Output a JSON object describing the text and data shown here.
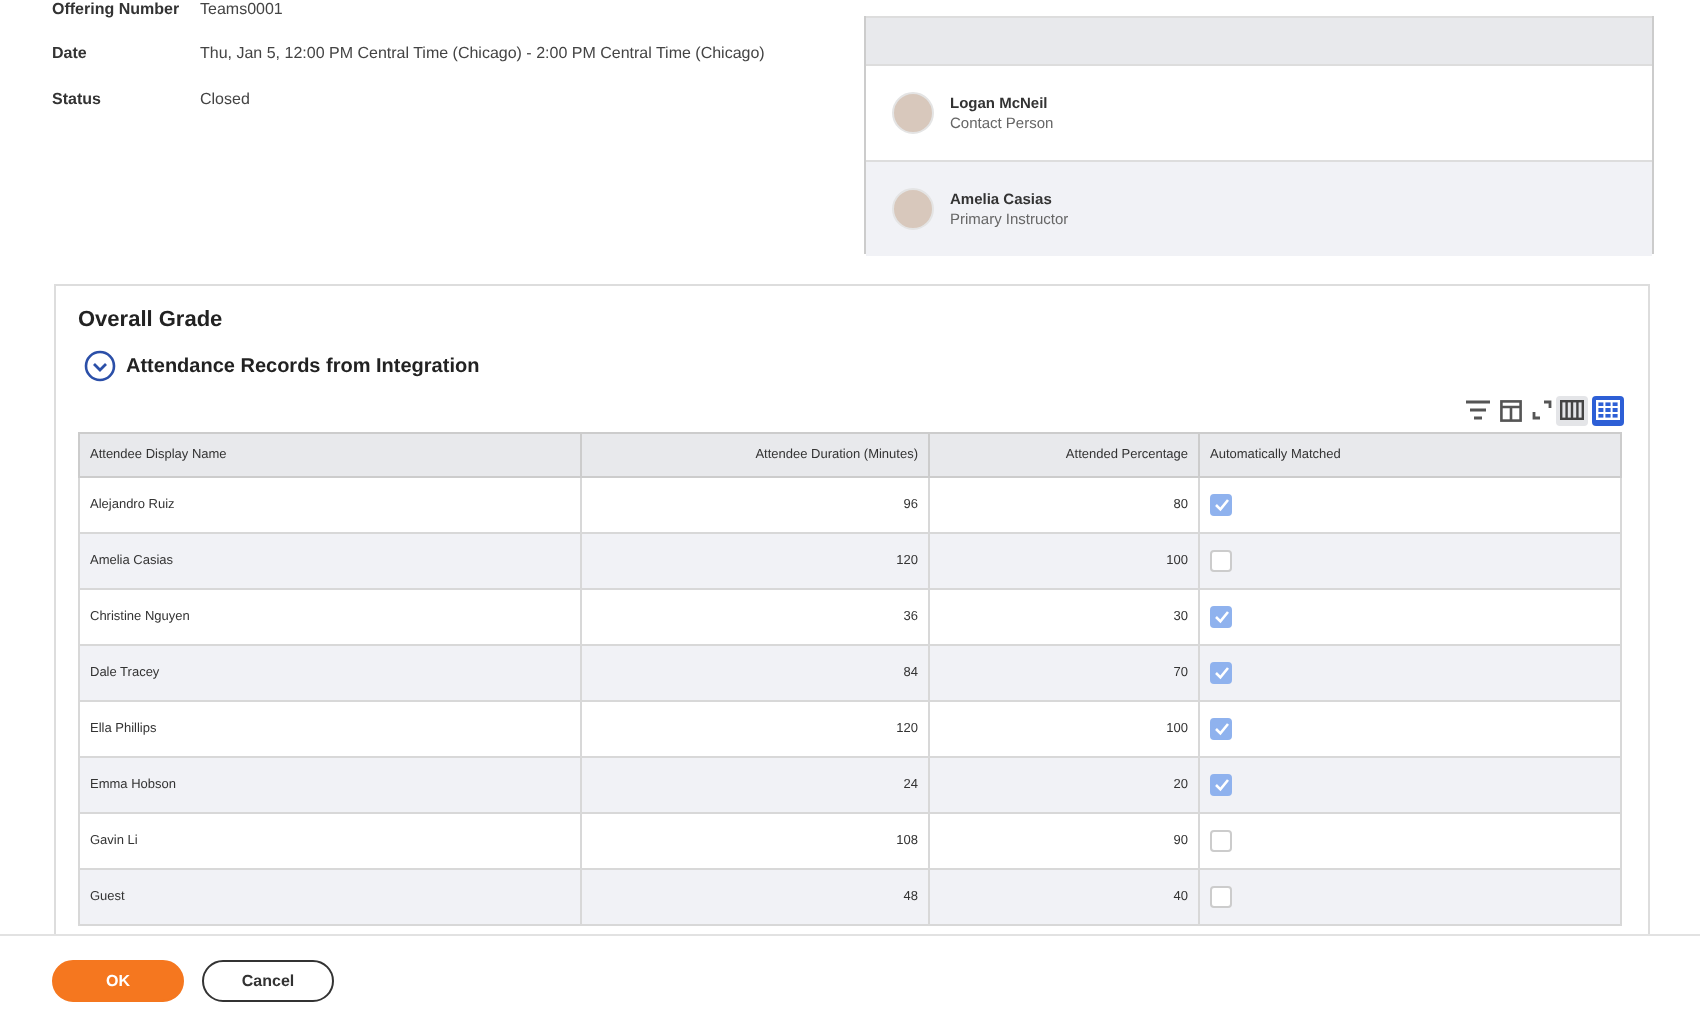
{
  "details": [
    {
      "label": "Offering Number",
      "value": "Teams0001"
    },
    {
      "label": "Date",
      "value": "Thu, Jan 5, 12:00 PM Central Time (Chicago)  -  2:00 PM Central Time (Chicago)"
    },
    {
      "label": "Status",
      "value": "Closed"
    }
  ],
  "contacts": [
    {
      "name": "Logan McNeil",
      "role": "Contact Person"
    },
    {
      "name": "Amelia Casias",
      "role": "Primary Instructor"
    }
  ],
  "grade": {
    "title": "Overall Grade",
    "section": {
      "title": "Attendance Records from Integration",
      "expanded": true
    },
    "view_modes": [
      {
        "kind": "columns",
        "selected": false
      },
      {
        "kind": "grid",
        "selected": true
      }
    ],
    "table": {
      "columns": [
        "Attendee Display Name",
        "Attendee Duration (Minutes)",
        "Attended Percentage",
        "Automatically Matched"
      ],
      "rows": [
        {
          "name": "Alejandro Ruiz",
          "duration": "96",
          "percentage": "80",
          "matched": true
        },
        {
          "name": "Amelia Casias",
          "duration": "120",
          "percentage": "100",
          "matched": false
        },
        {
          "name": "Christine Nguyen",
          "duration": "36",
          "percentage": "30",
          "matched": true
        },
        {
          "name": "Dale Tracey",
          "duration": "84",
          "percentage": "70",
          "matched": true
        },
        {
          "name": "Ella Phillips",
          "duration": "120",
          "percentage": "100",
          "matched": true
        },
        {
          "name": "Emma Hobson",
          "duration": "24",
          "percentage": "20",
          "matched": true
        },
        {
          "name": "Gavin Li",
          "duration": "108",
          "percentage": "90",
          "matched": false
        },
        {
          "name": "Guest",
          "duration": "48",
          "percentage": "40",
          "matched": false
        }
      ]
    }
  },
  "buttons": [
    {
      "kind": "primary",
      "label": "OK"
    },
    {
      "kind": "secondary",
      "label": "Cancel"
    }
  ]
}
